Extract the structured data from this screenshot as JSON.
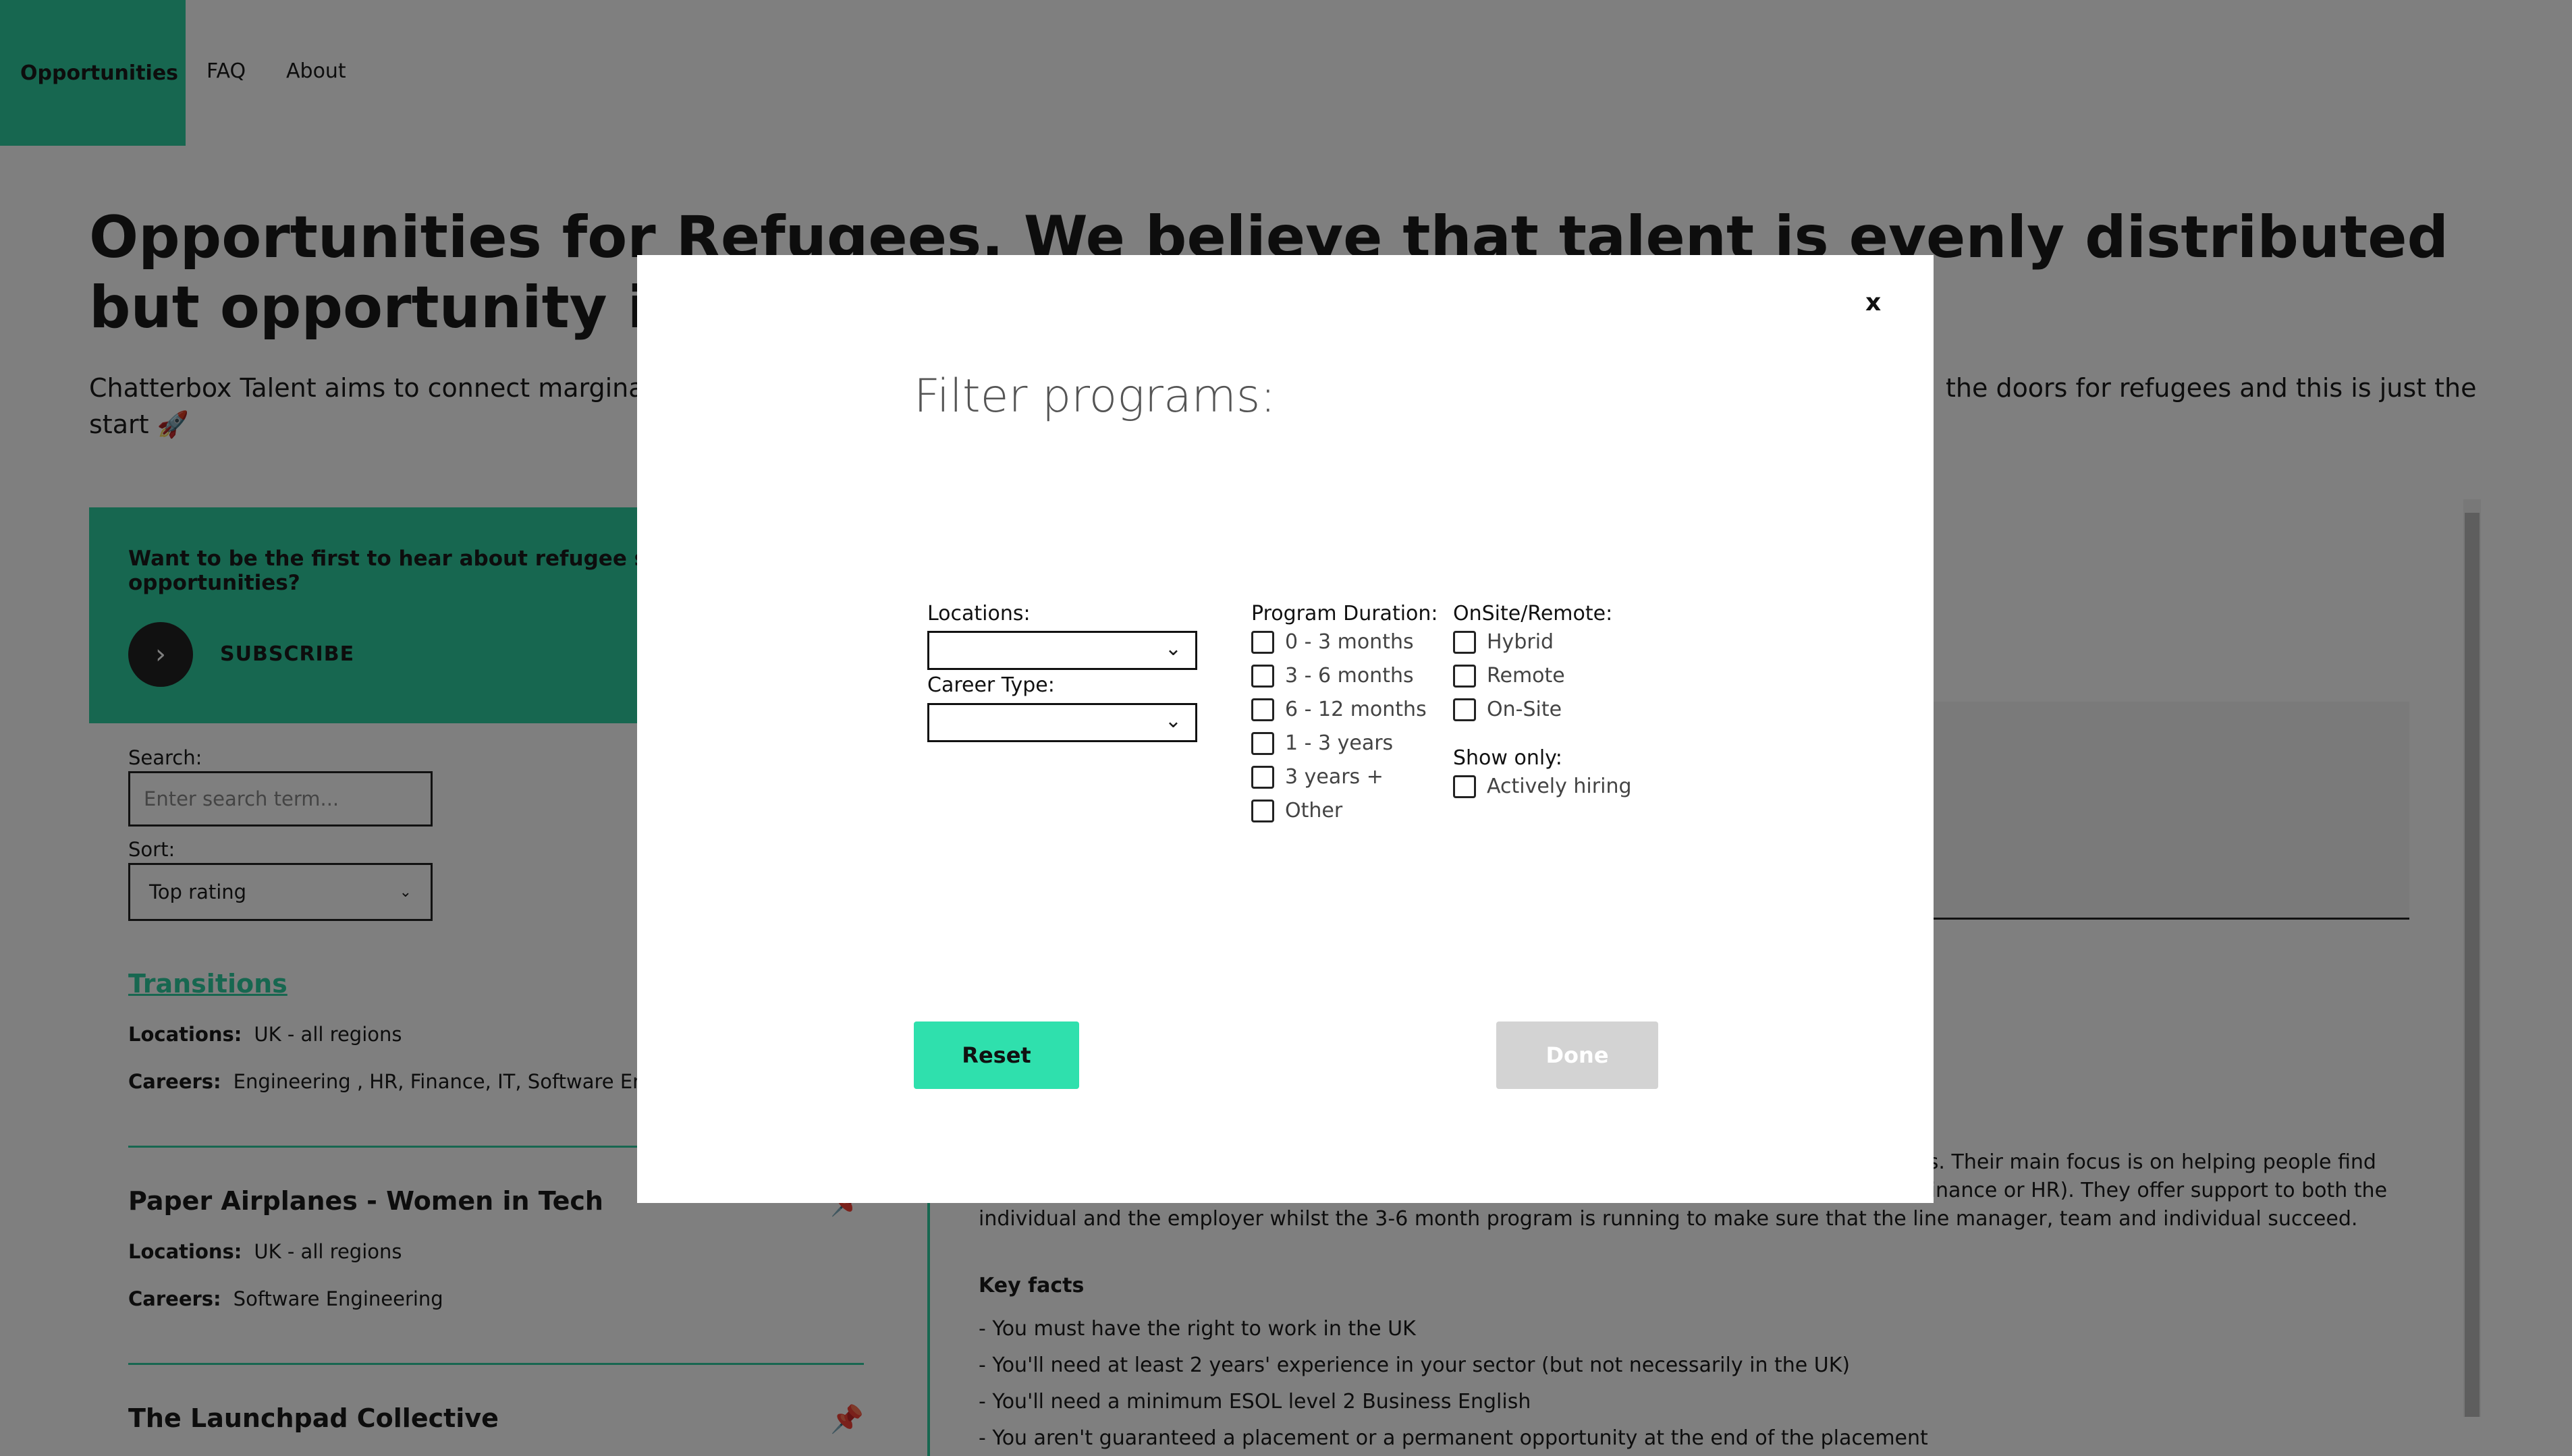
{
  "nav": {
    "items": [
      "Opportunities",
      "FAQ",
      "About"
    ]
  },
  "hero": {
    "title": "Opportunities for Refugees. We believe that talent is evenly distributed but opportunity is not!",
    "subtitle_left": "Chatterbox Talent aims to connect marginalise",
    "subtitle_right": "the doors for refugees and this is just the",
    "subtitle_end": "start 🚀"
  },
  "subscribe": {
    "text": "Want to be the first to hear about refugee scher opportunities?",
    "button_label": "SUBSCRIBE"
  },
  "search": {
    "label": "Search:",
    "placeholder": "Enter search term..."
  },
  "sort": {
    "label": "Sort:",
    "value": "Top rating"
  },
  "programs": [
    {
      "title": "Transitions",
      "locations_label": "Locations:",
      "locations": "UK - all regions",
      "careers_label": "Careers:",
      "careers": "Engineering , HR, Finance, IT, Software Engine"
    },
    {
      "title": "Paper Airplanes - Women in Tech",
      "locations_label": "Locations:",
      "locations": "UK - all regions",
      "careers_label": "Careers:",
      "careers": "Software Engineering"
    },
    {
      "title": "The Launchpad Collective"
    }
  ],
  "detail": {
    "desc_line1": "ies. Their main focus is on helping people find",
    "desc_line2": ", finance or HR). They offer support to both the",
    "desc_line3": "individual and the employer whilst the 3-6 month program is running to make sure that the line manager, team and individual succeed.",
    "facts_title": "Key facts",
    "facts": [
      "- You must have the right to work in the UK",
      "- You'll need at least 2 years' experience in your sector (but not necessarily in the UK)",
      "- You'll need a minimum ESOL level 2 Business English",
      "- You aren't guaranteed a placement or a permanent opportunity at the end of the placement"
    ]
  },
  "modal": {
    "close_label": "x",
    "title": "Filter programs:",
    "locations_label": "Locations:",
    "career_type_label": "Career Type:",
    "duration_label": "Program Duration:",
    "durations": [
      "0 - 3 months",
      "3 - 6 months",
      "6 - 12 months",
      "1 - 3 years",
      "3 years +",
      "Other"
    ],
    "onsite_label": "OnSite/Remote:",
    "onsite_options": [
      "Hybrid",
      "Remote",
      "On-Site"
    ],
    "show_only_label": "Show only:",
    "show_only_options": [
      "Actively hiring"
    ],
    "reset_label": "Reset",
    "done_label": "Done"
  },
  "colors": {
    "accent": "#2fcfa0",
    "reset_button": "#2fe0ad",
    "done_button_disabled": "#d3d3d3"
  }
}
